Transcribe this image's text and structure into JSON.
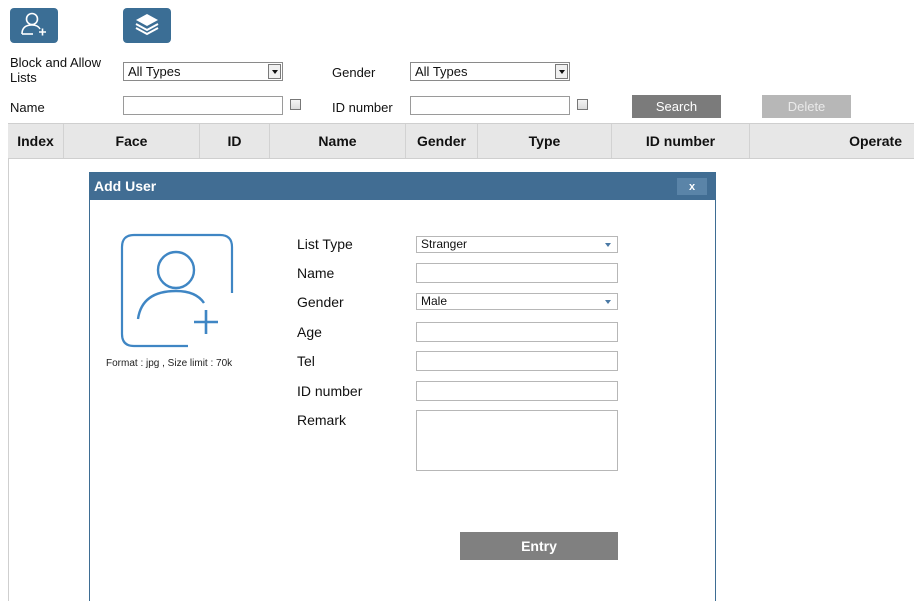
{
  "toolbar": {
    "add_user_icon": "add-user-icon",
    "batch_icon": "layers-icon"
  },
  "filters": {
    "list_label": "Block and Allow Lists",
    "list_value": "All Types",
    "gender_label": "Gender",
    "gender_value": "All Types",
    "name_label": "Name",
    "name_value": "",
    "id_label": "ID number",
    "id_value": "",
    "search_label": "Search",
    "delete_label": "Delete"
  },
  "table": {
    "columns": [
      "Index",
      "Face",
      "ID",
      "Name",
      "Gender",
      "Type",
      "ID number",
      "Operate"
    ]
  },
  "dialog": {
    "title": "Add User",
    "close_label": "x",
    "photo_hint": "Format : jpg , Size limit : 70k",
    "fields": {
      "list_type_label": "List Type",
      "list_type_value": "Stranger",
      "name_label": "Name",
      "name_value": "",
      "gender_label": "Gender",
      "gender_value": "Male",
      "age_label": "Age",
      "age_value": "",
      "tel_label": "Tel",
      "tel_value": "",
      "id_label": "ID number",
      "id_value": "",
      "remark_label": "Remark",
      "remark_value": ""
    },
    "entry_label": "Entry"
  },
  "colors": {
    "accent": "#3b6e95",
    "dialog_title": "#416d93",
    "button_gray": "#7b7b7b"
  }
}
